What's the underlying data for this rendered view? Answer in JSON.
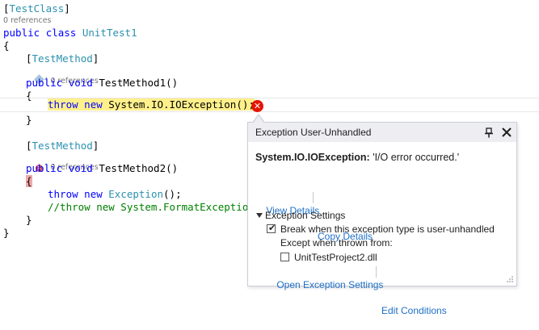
{
  "code": {
    "attr_class_open": "[",
    "attr_class": "TestClass",
    "attr_class_close": "]",
    "refs_class": "0 references",
    "public_kw": "public",
    "class_kw": "class",
    "class_name": "UnitTest1",
    "brace_open": "{",
    "brace_close": "}",
    "attr_method": "TestMethod",
    "refs_method1": "0 references",
    "refs_method2": "0 references",
    "void_kw": "void",
    "method1_sig": "TestMethod1()",
    "method2_sig": "TestMethod2()",
    "throw_kw": "throw",
    "new_kw": "new",
    "throw1_rest": "System.IO.IOException();",
    "throw2_type": "Exception",
    "throw2_rest": "();",
    "comment_line": "//throw new System.FormatException("
  },
  "popup": {
    "title": "Exception User-Unhandled",
    "exception_type": "System.IO.IOException:",
    "exception_message": " 'I/O error occurred.'",
    "view_details": "View Details",
    "copy_details": "Copy Details",
    "settings_header": "Exception Settings",
    "break_label": "Break when this exception type is user-unhandled",
    "break_checked": true,
    "except_label": "Except when thrown from:",
    "module_label": "UnitTestProject2.dll",
    "module_checked": false,
    "open_settings": "Open Exception Settings",
    "edit_conditions": "Edit Conditions"
  },
  "colors": {
    "keyword": "#0000ff",
    "type": "#2b91af",
    "comment": "#008000",
    "highlight": "#fff08c",
    "error": "#e51400",
    "link": "#1e6fc7"
  }
}
